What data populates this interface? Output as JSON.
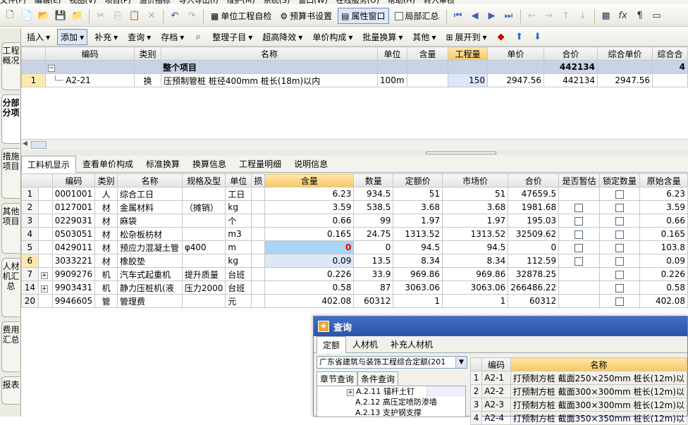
{
  "menu": [
    "文件(F)",
    "编辑(E)",
    "视图(V)",
    "项目(P)",
    "造价指标",
    "导入导出(I)",
    "维护(M)",
    "系统(S)",
    "窗口(W)",
    "在线服务(O)",
    "帮助(H)",
    "转入审核"
  ],
  "toolbar1": {
    "self_check": "单位工程自检",
    "budget_settings": "预算书设置",
    "property_window": "属性窗口",
    "local_summary": "局部汇总"
  },
  "toolbar2": {
    "insert": "插入",
    "add": "添加",
    "supplement": "补充",
    "query": "查询",
    "archive": "存档",
    "organize": "整理子目",
    "super_high": "超高降效",
    "unit_price": "单价构成",
    "batch_convert": "批量换算",
    "other": "其他",
    "expand_to": "展开到"
  },
  "left_tabs": [
    "工程概况",
    "分部分项",
    "措施项目",
    "其他项目",
    "人材机汇总",
    "费用汇总",
    "报表"
  ],
  "top_grid": {
    "columns": [
      "编码",
      "类别",
      "名称",
      "单位",
      "含量",
      "工程量",
      "单价",
      "合价",
      "综合单价",
      "综合合"
    ],
    "summary_row": {
      "name": "整个项目",
      "total": "442134",
      "partial": "4"
    },
    "rows": [
      {
        "no": "1",
        "code": "A2-21",
        "type": "换",
        "name": "压预制管桩 桩径400mm 桩长(18m)以内",
        "unit": "100m",
        "content": "",
        "qty": "150",
        "price": "2947.56",
        "total": "442134",
        "comp_price": "2947.56",
        "comp_total": ""
      }
    ]
  },
  "bottom_tabs": [
    "工料机显示",
    "查看单价构成",
    "标准换算",
    "换算信息",
    "工程量明细",
    "说明信息"
  ],
  "bottom_grid": {
    "columns": [
      "编码",
      "类别",
      "名称",
      "规格及型",
      "单位",
      "损",
      "含量",
      "数量",
      "定额价",
      "市场价",
      "合价",
      "是否暂估",
      "锁定数量",
      "原始含量"
    ],
    "rows": [
      {
        "no": "1",
        "exp": "",
        "code": "0001001",
        "type": "人",
        "name": "综合工日",
        "spec": "",
        "unit": "工日",
        "content": "6.23",
        "qty": "934.5",
        "base": "51",
        "market": "51",
        "total": "47659.5",
        "est": false,
        "lock": true,
        "orig": "6.23"
      },
      {
        "no": "2",
        "exp": "",
        "code": "0127001",
        "type": "材",
        "name": "金属材料",
        "spec": "（摊销）",
        "unit": "kg",
        "content": "3.59",
        "qty": "538.5",
        "base": "3.68",
        "market": "3.68",
        "total": "1981.68",
        "est": true,
        "lock": true,
        "orig": "3.59"
      },
      {
        "no": "3",
        "exp": "",
        "code": "0229031",
        "type": "材",
        "name": "麻袋",
        "spec": "",
        "unit": "个",
        "content": "0.66",
        "qty": "99",
        "base": "1.97",
        "market": "1.97",
        "total": "195.03",
        "est": true,
        "lock": true,
        "orig": "0.66"
      },
      {
        "no": "4",
        "exp": "",
        "code": "0503051",
        "type": "材",
        "name": "松杂板枋材",
        "spec": "",
        "unit": "m3",
        "content": "0.165",
        "qty": "24.75",
        "base": "1313.52",
        "market": "1313.52",
        "total": "32509.62",
        "est": true,
        "lock": true,
        "orig": "0.165"
      },
      {
        "no": "5",
        "exp": "",
        "code": "0429011",
        "type": "材",
        "name": "预应力混凝土管",
        "spec": "φ400",
        "unit": "m",
        "content": "0",
        "qty": "0",
        "base": "94.5",
        "market": "94.5",
        "total": "0",
        "est": true,
        "lock": true,
        "orig": "103.8"
      },
      {
        "no": "6",
        "exp": "",
        "code": "3033221",
        "type": "材",
        "name": "橡胶垫",
        "spec": "",
        "unit": "kg",
        "content": "0.09",
        "qty": "13.5",
        "base": "8.34",
        "market": "8.34",
        "total": "112.59",
        "est": true,
        "lock": true,
        "orig": "0.09"
      },
      {
        "no": "7",
        "exp": "+",
        "code": "9909276",
        "type": "机",
        "name": "汽车式起重机",
        "spec": "提升质量",
        "unit": "台班",
        "content": "0.226",
        "qty": "33.9",
        "base": "969.86",
        "market": "969.86",
        "total": "32878.25",
        "est": false,
        "lock": true,
        "orig": "0.226"
      },
      {
        "no": "14",
        "exp": "+",
        "code": "9903431",
        "type": "机",
        "name": "静力压桩机(液",
        "spec": "压力2000",
        "unit": "台班",
        "content": "0.58",
        "qty": "87",
        "base": "3063.06",
        "market": "3063.06",
        "total": "266486.22",
        "est": false,
        "lock": true,
        "orig": "0.58"
      },
      {
        "no": "20",
        "exp": "",
        "code": "9946605",
        "type": "管",
        "name": "管理费",
        "spec": "",
        "unit": "元",
        "content": "402.08",
        "qty": "60312",
        "base": "1",
        "market": "1",
        "total": "60312",
        "est": false,
        "lock": true,
        "orig": "402.08"
      }
    ]
  },
  "dialog": {
    "title": "查询",
    "tabs": [
      "定额",
      "人材机",
      "补充人材机"
    ],
    "quota_lib": "广东省建筑与装饰工程综合定额(201",
    "subtabs": [
      "章节查询",
      "条件查询"
    ],
    "tree": [
      "A.2.11 锚杆土钉",
      "A.2.12 高压定喷防渗墙",
      "A.2.13 支护钢支撑"
    ],
    "columns": [
      "编码",
      "名称"
    ],
    "rows": [
      {
        "no": "1",
        "code": "A2-1",
        "name": "打预制方桩 截面250×250mm 桩长(12m)以"
      },
      {
        "no": "2",
        "code": "A2-2",
        "name": "打预制方桩 截面300×300mm 桩长(12m)以"
      },
      {
        "no": "3",
        "code": "A2-3",
        "name": "打预制方桩 截面300×300mm 桩长(12m)以"
      },
      {
        "no": "4",
        "code": "A2-4",
        "name": "打预制方桩 截面350×350mm 桩长(12m)以"
      }
    ]
  }
}
